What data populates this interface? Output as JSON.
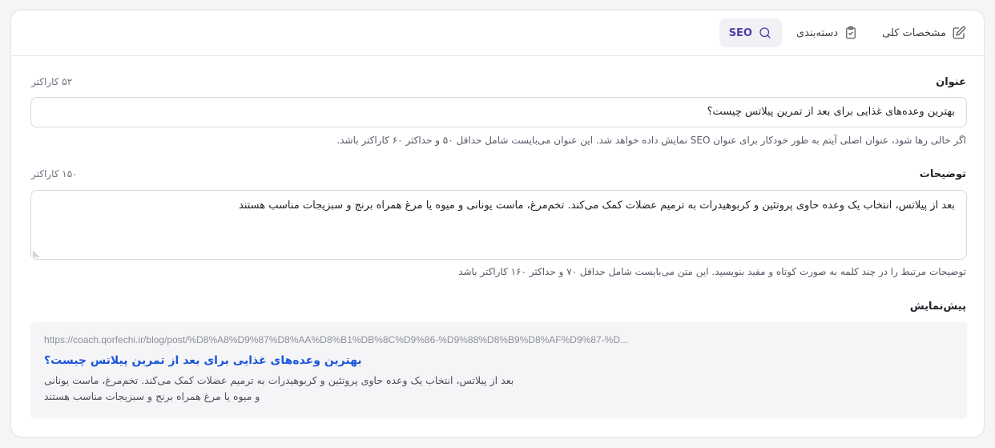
{
  "tabs": [
    {
      "label": "مشخصات کلی",
      "icon": "edit-icon",
      "active": false
    },
    {
      "label": "دسته‌بندی",
      "icon": "clipboard-check-icon",
      "active": false
    },
    {
      "label": "SEO",
      "icon": "search-icon",
      "active": true
    }
  ],
  "title_field": {
    "label": "عنوان",
    "counter": "۵۲ کاراکتر",
    "value": "بهترین وعده‌های غذایی برای بعد از تمرین پیلاتس چیست؟",
    "hint": "اگر خالی رها شود، عنوان اصلی آیتم به طور خودکار برای عنوان SEO نمایش داده خواهد شد. این عنوان می‌بایست شامل حداقل ۵۰ و حداکثر ۶۰ کاراکتر باشد."
  },
  "description_field": {
    "label": "توضیحات",
    "counter": "۱۵۰ کاراکتر",
    "value": "بعد از پیلاتس، انتخاب یک وعده حاوی پروتئین و کربوهیدرات به ترمیم عضلات کمک می‌کند. تخم‌مرغ، ماست یونانی و میوه یا مرغ همراه برنج و سبزیجات مناسب هستند",
    "hint": "توضیحات مرتبط را در چند کلمه به صورت کوتاه و مفید بنویسید. این متن می‌بایست شامل حداقل ۷۰ و حداکثر ۱۶۰ کاراکتر باشد"
  },
  "preview": {
    "label": "پیش‌نمایش",
    "url": "https://coach.qorfechi.ir/blog/post/%D8%A8%D9%87%D8%AA%D8%B1%DB%8C%D9%86-%D9%88%D8%B9%D8%AF%D9%87-%D...",
    "title": "بهترین وعده‌های غذایی برای بعد از تمرین پیلاتس چیست؟",
    "description_line1": "بعد از پیلاتس، انتخاب یک وعده حاوی پروتئین و کربوهیدرات به ترمیم عضلات کمک می‌کند. تخم‌مرغ، ماست یونانی",
    "description_line2": "و میوه یا مرغ همراه برنج و سبزیجات مناسب هستند"
  },
  "colors": {
    "accent": "#4b3fa8",
    "link": "#1a56db",
    "active_tab_bg": "#f1f1f5",
    "preview_bg": "#f5f5f7"
  }
}
